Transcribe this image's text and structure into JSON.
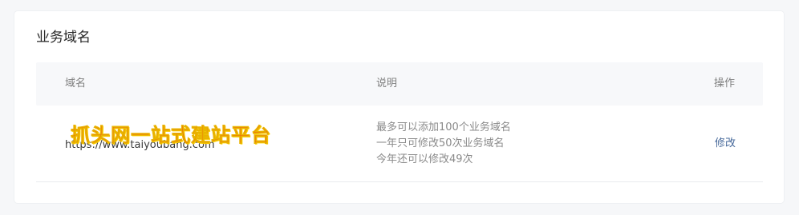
{
  "section": {
    "title": "业务域名"
  },
  "table": {
    "headers": {
      "domain": "域名",
      "description": "说明",
      "operation": "操作"
    },
    "rows": [
      {
        "domain": "https://www.taiyoubang.com",
        "description_lines": [
          "最多可以添加100个业务域名",
          "一年只可修改50次业务域名",
          "今年还可以修改49次"
        ],
        "action": "修改"
      }
    ]
  },
  "watermark": {
    "text": "抓头网一站式建站平台"
  },
  "colors": {
    "page_background": "#f6f7f9",
    "card_background": "#ffffff",
    "header_background": "#f7f8fa",
    "link": "#46689a",
    "watermark": "#f3430f"
  }
}
